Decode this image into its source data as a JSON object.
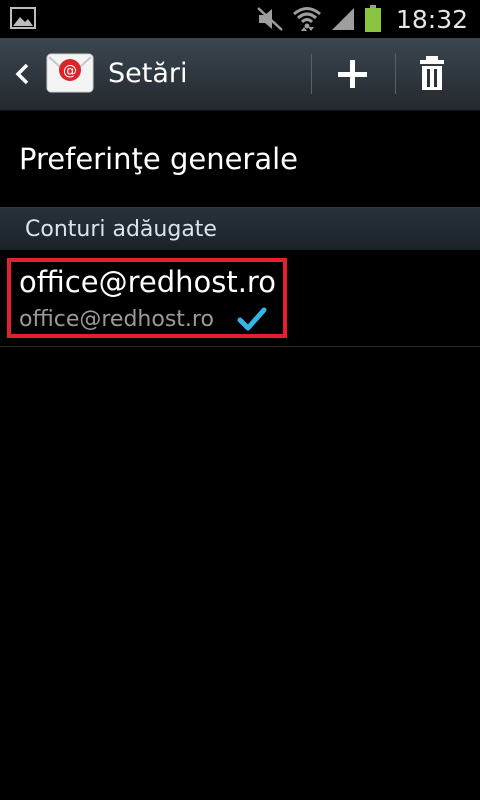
{
  "status_bar": {
    "time": "18:32",
    "icons": [
      "gallery-icon",
      "mute-icon",
      "wifi-icon",
      "signal-icon",
      "battery-icon"
    ],
    "battery_color": "#8bc53f"
  },
  "action_bar": {
    "title": "Setări",
    "app_icon": "email-app-icon",
    "actions": [
      "add-icon",
      "trash-icon"
    ]
  },
  "preferences": {
    "label": "Preferinţe generale"
  },
  "accounts_section": {
    "header": "Conturi adăugate",
    "accounts": [
      {
        "name": "office@redhost.ro",
        "email": "office@redhost.ro",
        "checked": true
      }
    ]
  },
  "colors": {
    "highlight": "#e3202b",
    "check": "#33b5e5"
  }
}
